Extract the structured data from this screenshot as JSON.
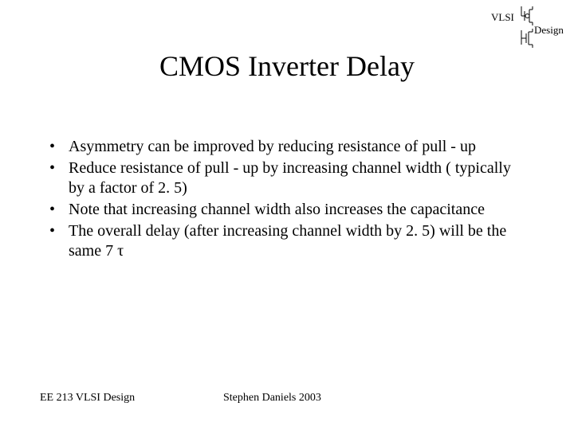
{
  "header": {
    "vlsi": "VLSI",
    "design": "Design"
  },
  "title": "CMOS Inverter Delay",
  "bullets": [
    "Asymmetry can be improved by reducing resistance of pull - up",
    "Reduce resistance of pull - up by increasing channel width ( typically by a factor of 2. 5)",
    "Note that increasing channel width also increases the capacitance",
    "The overall delay (after increasing channel width by 2. 5) will be the same 7 τ"
  ],
  "footer": {
    "left": "EE 213 VLSI Design",
    "center": "Stephen Daniels 2003"
  }
}
